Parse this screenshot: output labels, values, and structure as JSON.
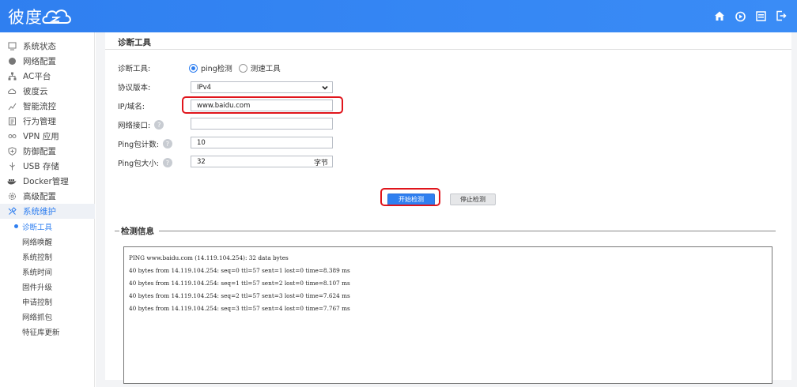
{
  "header": {
    "logo_text": "彼度",
    "icons": [
      "home-icon",
      "power-icon",
      "window-icon",
      "logout-icon"
    ]
  },
  "sidebar": {
    "items": [
      {
        "label": "系统状态",
        "icon": "monitor-icon"
      },
      {
        "label": "网络配置",
        "icon": "globe-icon"
      },
      {
        "label": "AC平台",
        "icon": "network-icon"
      },
      {
        "label": "彼度云",
        "icon": "cloud-icon"
      },
      {
        "label": "智能流控",
        "icon": "chart-icon"
      },
      {
        "label": "行为管理",
        "icon": "document-icon"
      },
      {
        "label": "VPN 应用",
        "icon": "vpn-icon"
      },
      {
        "label": "防御配置",
        "icon": "shield-icon"
      },
      {
        "label": "USB 存储",
        "icon": "usb-icon"
      },
      {
        "label": "Docker管理",
        "icon": "docker-icon"
      },
      {
        "label": "高级配置",
        "icon": "gear-icon"
      },
      {
        "label": "系统维护",
        "icon": "tools-icon"
      }
    ],
    "sub_items": [
      {
        "label": "诊断工具"
      },
      {
        "label": "网络唤醒"
      },
      {
        "label": "系统控制"
      },
      {
        "label": "系统时间"
      },
      {
        "label": "固件升级"
      },
      {
        "label": "申请控制"
      },
      {
        "label": "网络抓包"
      },
      {
        "label": "特征库更新"
      }
    ]
  },
  "page": {
    "title": "诊断工具"
  },
  "form": {
    "tool_label": "诊断工具:",
    "tool_option_ping": "ping检测",
    "tool_option_speed": "测速工具",
    "protocol_label": "协议版本:",
    "protocol_value": "IPv4",
    "host_label": "IP/域名:",
    "host_value": "www.baidu.com",
    "interface_label": "网络接口:",
    "interface_value": "",
    "count_label": "Ping包计数:",
    "count_value": "10",
    "size_label": "Ping包大小:",
    "size_value": "32",
    "size_unit": "字节"
  },
  "actions": {
    "start_label": "开始检测",
    "stop_label": "停止检测"
  },
  "result": {
    "section_title": "检测信息",
    "lines": [
      "PING www.baidu.com (14.119.104.254): 32 data bytes",
      "40 bytes from 14.119.104.254: seq=0 ttl=57 sent=1 lost=0 time=8.389 ms",
      "40 bytes from 14.119.104.254: seq=1 ttl=57 sent=2 lost=0 time=8.107 ms",
      "40 bytes from 14.119.104.254: seq=2 ttl=57 sent=3 lost=0 time=7.624 ms",
      "40 bytes from 14.119.104.254: seq=3 ttl=57 sent=4 lost=0 time=7.767 ms"
    ]
  },
  "colors": {
    "header_bg": "#2f7ff0",
    "accent": "#2f7ff0",
    "highlight_border": "#e0151c"
  }
}
